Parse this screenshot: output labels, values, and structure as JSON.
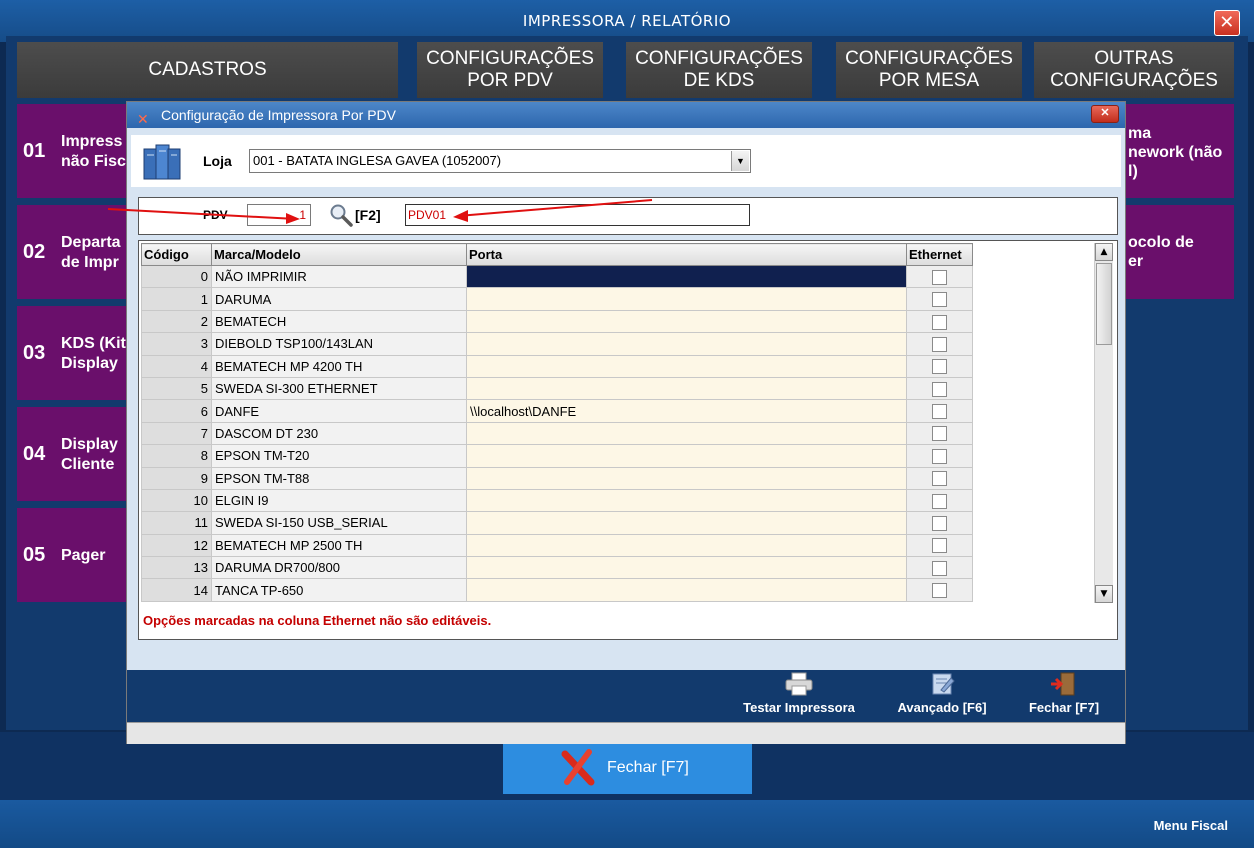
{
  "app": {
    "title": "IMPRESSORA / RELATÓRIO",
    "close_label": "✕"
  },
  "tabs": [
    {
      "label": "CADASTROS"
    },
    {
      "label": "CONFIGURAÇÕES\nPOR PDV"
    },
    {
      "label": "CONFIGURAÇÕES\nDE KDS"
    },
    {
      "label": "CONFIGURAÇÕES\nPOR MESA"
    },
    {
      "label": "OUTRAS\nCONFIGURAÇÕES"
    }
  ],
  "side_cards": [
    {
      "num": "01",
      "label": "Impress\nnão Fisc"
    },
    {
      "num": "02",
      "label": "Departa\nde Impr"
    },
    {
      "num": "03",
      "label": "KDS (Kit\nDisplay"
    },
    {
      "num": "04",
      "label": "Display\nCliente"
    },
    {
      "num": "05",
      "label": "Pager"
    }
  ],
  "right_cards": [
    {
      "label": "ma\nnework (não\nl)"
    },
    {
      "label": "ocolo de\ner"
    }
  ],
  "dialog": {
    "title": "Configuração de Impressora Por PDV",
    "close_label": "✕",
    "loja_label": "Loja",
    "loja_value": "001 - BATATA INGLESA GAVEA (1052007)",
    "pdv_label": "PDV",
    "pdv_value": "1",
    "f2_label": "[F2]",
    "pdv_name": "PDV01",
    "columns": {
      "codigo": "Código",
      "marca": "Marca/Modelo",
      "porta": "Porta",
      "ethernet": "Ethernet"
    },
    "rows": [
      {
        "codigo": "0",
        "marca": "NÃO IMPRIMIR",
        "porta": ""
      },
      {
        "codigo": "1",
        "marca": "DARUMA",
        "porta": ""
      },
      {
        "codigo": "2",
        "marca": "BEMATECH",
        "porta": ""
      },
      {
        "codigo": "3",
        "marca": "DIEBOLD TSP100/143LAN",
        "porta": ""
      },
      {
        "codigo": "4",
        "marca": "BEMATECH MP 4200 TH",
        "porta": ""
      },
      {
        "codigo": "5",
        "marca": "SWEDA SI-300 ETHERNET",
        "porta": ""
      },
      {
        "codigo": "6",
        "marca": "DANFE",
        "porta": "\\\\localhost\\DANFE"
      },
      {
        "codigo": "7",
        "marca": "DASCOM DT 230",
        "porta": ""
      },
      {
        "codigo": "8",
        "marca": "EPSON TM-T20",
        "porta": ""
      },
      {
        "codigo": "9",
        "marca": "EPSON TM-T88",
        "porta": ""
      },
      {
        "codigo": "10",
        "marca": "ELGIN I9",
        "porta": ""
      },
      {
        "codigo": "11",
        "marca": "SWEDA SI-150 USB_SERIAL",
        "porta": ""
      },
      {
        "codigo": "12",
        "marca": "BEMATECH MP 2500 TH",
        "porta": ""
      },
      {
        "codigo": "13",
        "marca": "DARUMA DR700/800",
        "porta": ""
      },
      {
        "codigo": "14",
        "marca": "TANCA TP-650",
        "porta": ""
      }
    ],
    "note": "Opções marcadas na coluna Ethernet não são editáveis.",
    "toolbar": {
      "test_label": "Testar Impressora",
      "advanced_label": "Avançado [F6]",
      "close_label": "Fechar [F7]"
    }
  },
  "main_close_label": "Fechar [F7]",
  "footer": {
    "menu_label": "Menu Fiscal"
  },
  "colors": {
    "title_blue": "#1d5fa6",
    "card_purple": "#6a0f6b",
    "accent_blue": "#2d8de0",
    "note_red": "#c40000"
  }
}
